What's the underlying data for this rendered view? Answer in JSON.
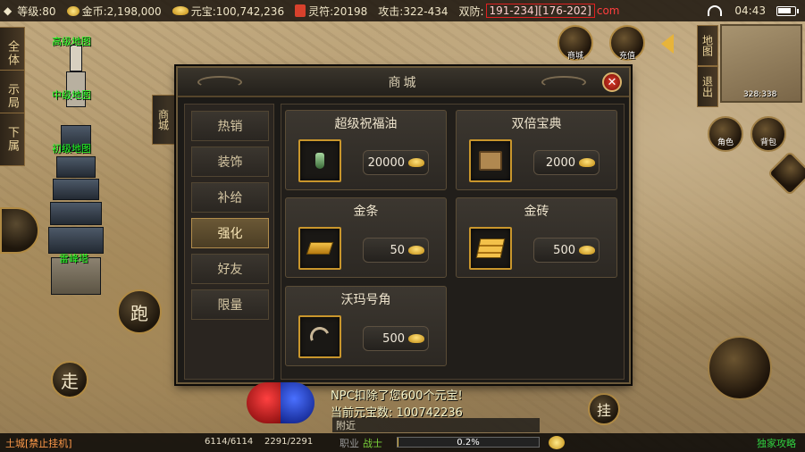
{
  "status_bar": {
    "level": "等级:80",
    "gold": "金币:2,198,000",
    "yuanbao": "元宝:100,742,236",
    "lingfu": "灵符:20198",
    "attack": "攻击:322-434",
    "defense_label": "双防:",
    "defense_values": "191-234][176-202]",
    "overlay_text": "com",
    "time": "04:43"
  },
  "left_menu": {
    "btn1": "全体",
    "btn2": "示局",
    "btn3": "下属"
  },
  "map_labels": {
    "high": "高级地图",
    "mid": "中级地图",
    "low": "初级地图",
    "tower": "雷峰塔"
  },
  "controls": {
    "run": "跑",
    "walk": "走",
    "auto": "挂"
  },
  "top_right": {
    "shop": "商城",
    "recharge": "充值",
    "map_btn": "地图",
    "exit_btn": "退出",
    "minimap_coords": "328:338",
    "char_btn": "角色",
    "bag_btn": "背包"
  },
  "shop": {
    "title": "商城",
    "side_tab": "商城",
    "tabs": [
      {
        "label": "热销"
      },
      {
        "label": "装饰"
      },
      {
        "label": "补给"
      },
      {
        "label": "强化"
      },
      {
        "label": "好友"
      },
      {
        "label": "限量"
      }
    ],
    "active_tab": "强化",
    "items": [
      {
        "name": "超级祝福油",
        "price": "20000",
        "icon": "potion-bottle-icon"
      },
      {
        "name": "双倍宝典",
        "price": "2000",
        "icon": "book-icon"
      },
      {
        "name": "金条",
        "price": "50",
        "icon": "gold-bar-icon"
      },
      {
        "name": "金砖",
        "price": "500",
        "icon": "gold-brick-icon"
      },
      {
        "name": "沃玛号角",
        "price": "500",
        "icon": "horn-icon"
      }
    ]
  },
  "chat": {
    "line1": "NPC扣除了您600个元宝!",
    "line2": "当前元宝数: 100742236",
    "input_placeholder": "附近"
  },
  "bottom_bar": {
    "location": "土城[禁止挂机]",
    "hp": "6114/6114",
    "mp": "2291/2291",
    "job_label": "职业",
    "job_value": "战士",
    "exp_percent": "0.2%",
    "exp_fraction": 0.002,
    "right_hint": "独家攻略"
  },
  "colors": {
    "accent_gold": "#c9962c",
    "panel_bg": "#1c1a17",
    "map_label_green": "#22ff22",
    "location_orange": "#ff9a4a"
  }
}
